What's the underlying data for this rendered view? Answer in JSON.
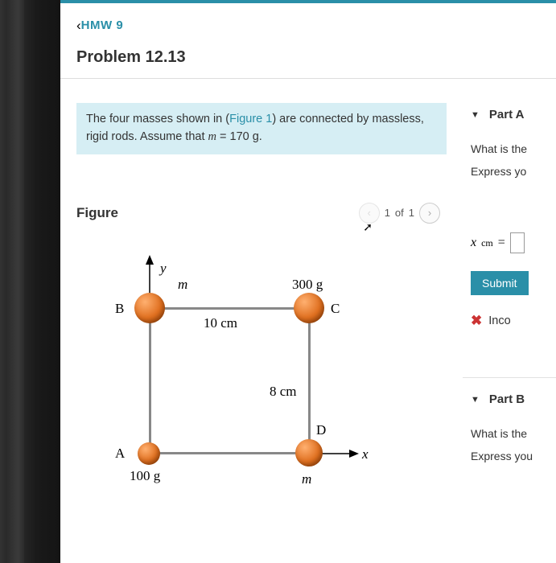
{
  "breadcrumb": {
    "label": "HMW 9"
  },
  "title": "Problem 12.13",
  "problem": {
    "pre": "The four masses shown in (",
    "figlink": "Figure 1",
    "post1": ") are connected by massless, rigid rods. Assume that ",
    "mvar": "m",
    "post2": " = 170 g."
  },
  "figure": {
    "heading": "Figure",
    "pager_current": "1",
    "pager_of": "of",
    "pager_total": "1",
    "labels": {
      "A": "A",
      "B": "B",
      "C": "C",
      "D": "D",
      "x": "x",
      "y": "y",
      "m_top": "m",
      "m_bottom": "m",
      "mass_A": "100 g",
      "mass_C": "300 g",
      "width": "10 cm",
      "height": "8 cm"
    }
  },
  "partA": {
    "label": "Part A",
    "question": "What is the",
    "instruction": "Express yo",
    "var": "x",
    "sub": "cm",
    "eq": " = ",
    "submit": "Submit",
    "feedback": "Inco"
  },
  "partB": {
    "label": "Part B",
    "question": "What is the ",
    "instruction": "Express you"
  }
}
